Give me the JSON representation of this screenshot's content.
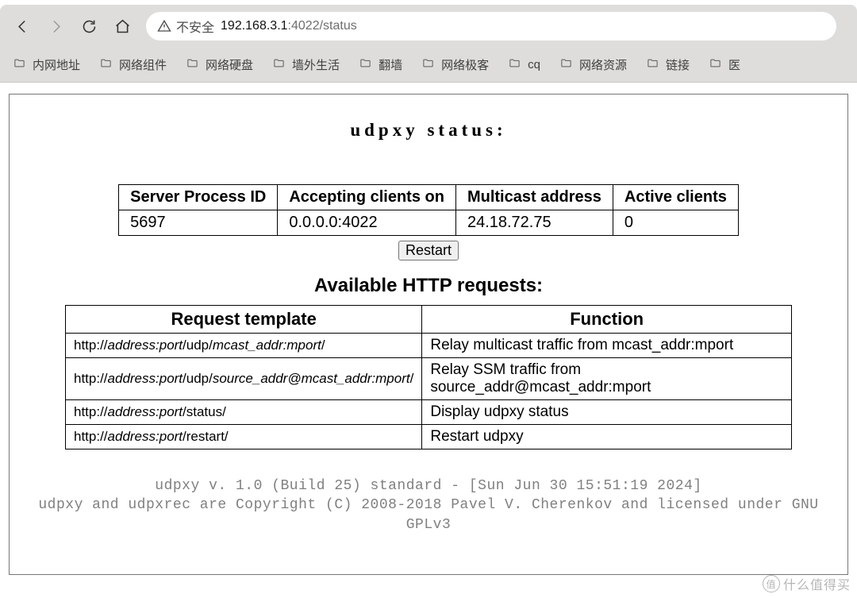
{
  "browser": {
    "security_label": "不安全",
    "url_host": "192.168.3.1",
    "url_rest": ":4022/status",
    "bookmarks": [
      "内网地址",
      "网络组件",
      "网络硬盘",
      "墙外生活",
      "翻墙",
      "网络极客",
      "cq",
      "网络资源",
      "链接",
      "医"
    ]
  },
  "page": {
    "title": "udpxy status:",
    "status_headers": [
      "Server Process ID",
      "Accepting clients on",
      "Multicast address",
      "Active clients"
    ],
    "status_row": [
      "5697",
      "0.0.0.0:4022",
      "24.18.72.75",
      "0"
    ],
    "restart_label": "Restart",
    "requests_heading": "Available HTTP requests:",
    "requests_headers": [
      "Request template",
      "Function"
    ],
    "requests": [
      {
        "tpl_prefix": "http://",
        "tpl_ap": "address:port",
        "tpl_mid": "/udp/",
        "tpl_var": "mcast_addr:mport",
        "tpl_suffix": "/",
        "func": "Relay multicast traffic from mcast_addr:mport"
      },
      {
        "tpl_prefix": "http://",
        "tpl_ap": "address:port",
        "tpl_mid": "/udp/",
        "tpl_var": "source_addr@mcast_addr:mport",
        "tpl_suffix": "/",
        "func": "Relay SSM traffic from source_addr@mcast_addr:mport"
      },
      {
        "tpl_prefix": "http://",
        "tpl_ap": "address:port",
        "tpl_mid": "/status/",
        "tpl_var": "",
        "tpl_suffix": "",
        "func": "Display udpxy status"
      },
      {
        "tpl_prefix": "http://",
        "tpl_ap": "address:port",
        "tpl_mid": "/restart/",
        "tpl_var": "",
        "tpl_suffix": "",
        "func": "Restart udpxy"
      }
    ],
    "footer_line1": "udpxy v. 1.0 (Build 25) standard - [Sun Jun 30 15:51:19 2024]",
    "footer_line2": "udpxy and udpxrec are Copyright (C) 2008-2018 Pavel V. Cherenkov and licensed under GNU GPLv3"
  },
  "watermark": "什么值得买"
}
